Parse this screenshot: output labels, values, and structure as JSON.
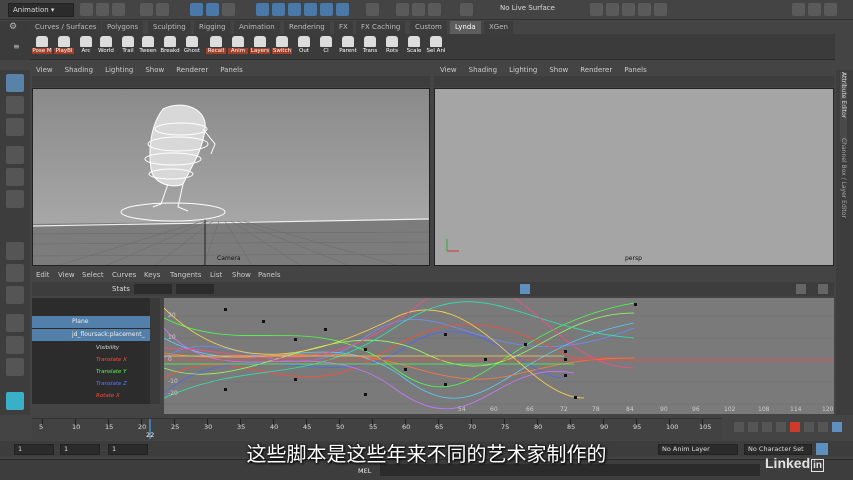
{
  "colors": {
    "accent": "#5d8cbf",
    "translate_x": "#ff4a3a",
    "translate_y": "#4cff4c",
    "translate_z": "#5a78ff",
    "rotate_x": "#ff4a3a"
  },
  "topbar": {
    "mode": "Animation",
    "live_surface": "No Live Surface"
  },
  "shelf_tabs": [
    "Curves / Surfaces",
    "Polygons",
    "Sculpting",
    "Rigging",
    "Animation",
    "Rendering",
    "FX",
    "FX Caching",
    "Custom",
    "Lynda",
    "XGen"
  ],
  "shelf_active": "Lynda",
  "shelf_buttons": [
    "Pose M",
    "PlayBl",
    "Arc",
    "World",
    "Trail",
    "Tween",
    "Breakd",
    "Ghost",
    "Recall",
    "Anim",
    "Layers",
    "Switch",
    "Out",
    "Cl",
    "Parent",
    "Trans",
    "Rots",
    "Scale",
    "Sel Anl"
  ],
  "viewport_menu": [
    "View",
    "Shading",
    "Lighting",
    "Show",
    "Renderer",
    "Panels"
  ],
  "viewport_left": {
    "label": "Camera"
  },
  "viewport_right": {
    "label": "persp"
  },
  "side_tabs": [
    "Attribute Editor",
    "Channel Box / Layer Editor"
  ],
  "graph_editor": {
    "menu": [
      "Edit",
      "View",
      "Select",
      "Curves",
      "Keys",
      "Tangents",
      "List",
      "Show",
      "Panels"
    ],
    "stats_label": "Stats",
    "outliner": {
      "items": [
        {
          "label": "Plane",
          "selected": true
        },
        {
          "label": "jd_floursack:placement_",
          "selected": true
        }
      ],
      "channels": [
        {
          "label": "Visibility",
          "color": "#dddddd"
        },
        {
          "label": "Translate X",
          "color": "#ff4a3a"
        },
        {
          "label": "Translate Y",
          "color": "#4cff4c"
        },
        {
          "label": "Translate Z",
          "color": "#5a78ff"
        },
        {
          "label": "Rotate X",
          "color": "#ff4a3a"
        }
      ]
    },
    "y_ticks": [
      "20",
      "10",
      "0",
      "-10",
      "-20"
    ],
    "x_ticks": [
      "54",
      "60",
      "66",
      "72",
      "78",
      "84",
      "90",
      "96",
      "102",
      "108",
      "114",
      "120"
    ]
  },
  "timeline": {
    "ticks": [
      "5",
      "10",
      "15",
      "20",
      "25",
      "30",
      "35",
      "40",
      "45",
      "50",
      "55",
      "60",
      "65",
      "70",
      "75",
      "80",
      "85",
      "90",
      "95",
      "100",
      "105"
    ],
    "current_frame": "22"
  },
  "range": {
    "start": "1",
    "start2": "1",
    "field3": "1",
    "no_anim_layer": "No Anim Layer",
    "no_character_set": "No Character Set"
  },
  "command": {
    "mel": "MEL"
  },
  "subtitle": "这些脚本是这些年来不同的艺术家制作的",
  "brand": {
    "text": "Linked",
    "suffix": "in"
  }
}
